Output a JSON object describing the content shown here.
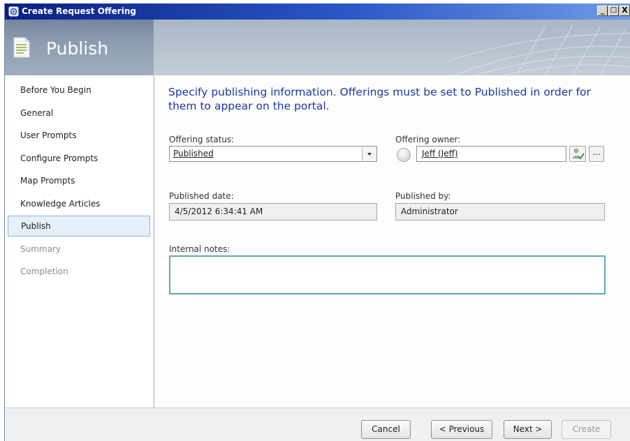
{
  "window": {
    "title": "Create Request Offering",
    "minimize_label": "_",
    "maximize_label": "□",
    "close_label": "X"
  },
  "banner": {
    "heading": "Publish"
  },
  "sidebar": {
    "items": [
      {
        "label": "Before You Begin",
        "state": "normal"
      },
      {
        "label": "General",
        "state": "normal"
      },
      {
        "label": "User Prompts",
        "state": "normal"
      },
      {
        "label": "Configure Prompts",
        "state": "normal"
      },
      {
        "label": "Map Prompts",
        "state": "normal"
      },
      {
        "label": "Knowledge Articles",
        "state": "normal"
      },
      {
        "label": "Publish",
        "state": "selected"
      },
      {
        "label": "Summary",
        "state": "disabled"
      },
      {
        "label": "Completion",
        "state": "disabled"
      }
    ]
  },
  "main": {
    "heading": "Specify publishing information.  Offerings must be set to Published in order for them to appear on the portal.",
    "offering_status": {
      "label": "Offering status:",
      "value": "Published"
    },
    "offering_owner": {
      "label": "Offering owner:",
      "value": "Jeff (Jeff)",
      "browse_label": "..."
    },
    "published_date": {
      "label": "Published date:",
      "value": "4/5/2012 6:34:41 AM"
    },
    "published_by": {
      "label": "Published by:",
      "value": "Administrator"
    },
    "internal_notes": {
      "label": "Internal notes:",
      "value": ""
    }
  },
  "footer": {
    "cancel_label": "Cancel",
    "previous_label": "< Previous",
    "next_label": "Next >",
    "create_label": "Create"
  },
  "colors": {
    "heading_blue": "#1d38a8",
    "titlebar_blue": "#0a1f84",
    "selected_bg": "#e6f0fa",
    "notes_border": "#5fa8b8"
  }
}
